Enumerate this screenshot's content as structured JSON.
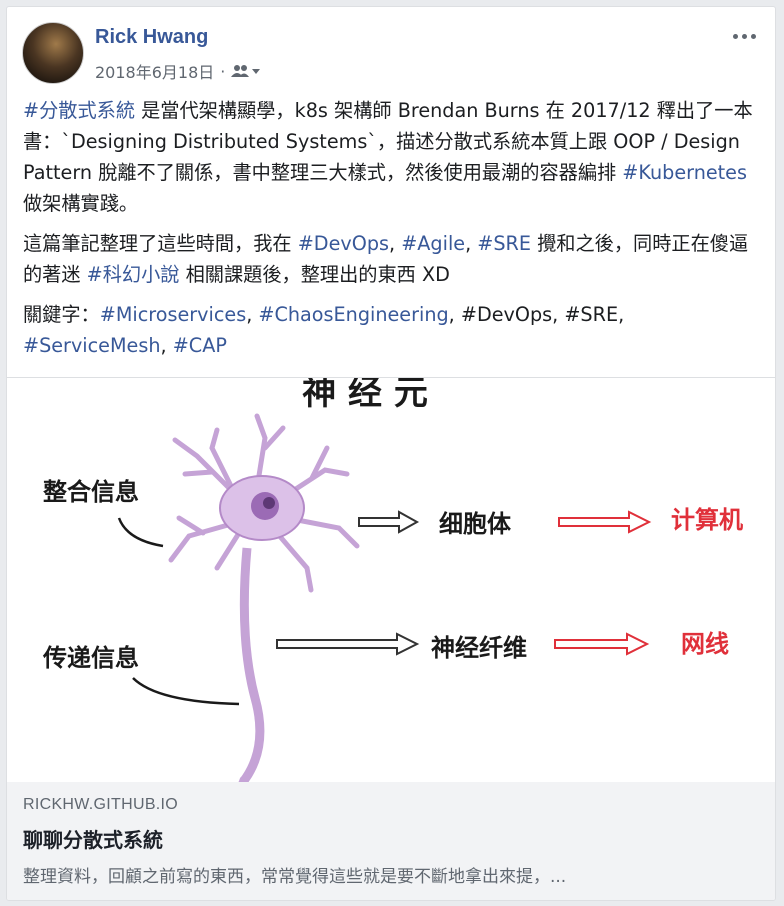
{
  "post": {
    "author": "Rick Hwang",
    "date": "2018年6月18日",
    "separator": "·",
    "audience_icon": "friends-icon",
    "more_icon": "more-options-icon",
    "paragraphs": [
      [
        {
          "text": "#分散式系統",
          "tag": true
        },
        {
          "text": " 是當代架構顯學，k8s 架構師 Brendan Burns 在 2017/12 釋出了一本書：`Designing Distributed Systems`，描述分散式系統本質上跟 OOP / Design Pattern 脫離不了關係，書中整理三大樣式，然後使用最潮的容器編排 ",
          "tag": false
        },
        {
          "text": "#Kubernetes",
          "tag": true
        },
        {
          "text": " 做架構實踐。",
          "tag": false
        }
      ],
      [
        {
          "text": "這篇筆記整理了這些時間，我在 ",
          "tag": false
        },
        {
          "text": "#DevOps",
          "tag": true
        },
        {
          "text": ", ",
          "tag": false
        },
        {
          "text": "#Agile",
          "tag": true
        },
        {
          "text": ", ",
          "tag": false
        },
        {
          "text": "#SRE",
          "tag": true
        },
        {
          "text": " 攪和之後，同時正在傻逼的著迷 ",
          "tag": false
        },
        {
          "text": "#科幻小說",
          "tag": true
        },
        {
          "text": " 相關課題後，整理出的東西 XD",
          "tag": false
        }
      ],
      [
        {
          "text": "關鍵字：",
          "tag": false
        },
        {
          "text": "#Microservices",
          "tag": true
        },
        {
          "text": ", ",
          "tag": false
        },
        {
          "text": "#ChaosEngineering",
          "tag": true
        },
        {
          "text": ", #DevOps, #SRE, ",
          "tag": false
        },
        {
          "text": "#ServiceMesh",
          "tag": true
        },
        {
          "text": ", ",
          "tag": false
        },
        {
          "text": "#CAP",
          "tag": true
        }
      ]
    ]
  },
  "image": {
    "title": "神 经 元",
    "left_top": "整合信息",
    "left_bottom": "传递信息",
    "mid_top": "细胞体",
    "mid_bottom": "神经纤维",
    "right_top": "计算机",
    "right_bottom": "网线"
  },
  "link": {
    "domain": "RICKHW.GITHUB.IO",
    "title": "聊聊分散式系統",
    "description": "整理資料，回顧之前寫的東西，常常覺得這些就是要不斷地拿出來提，..."
  },
  "colors": {
    "link_blue": "#385898",
    "arrow_red": "#e0303a",
    "neuron_purple": "#b48ac8"
  }
}
